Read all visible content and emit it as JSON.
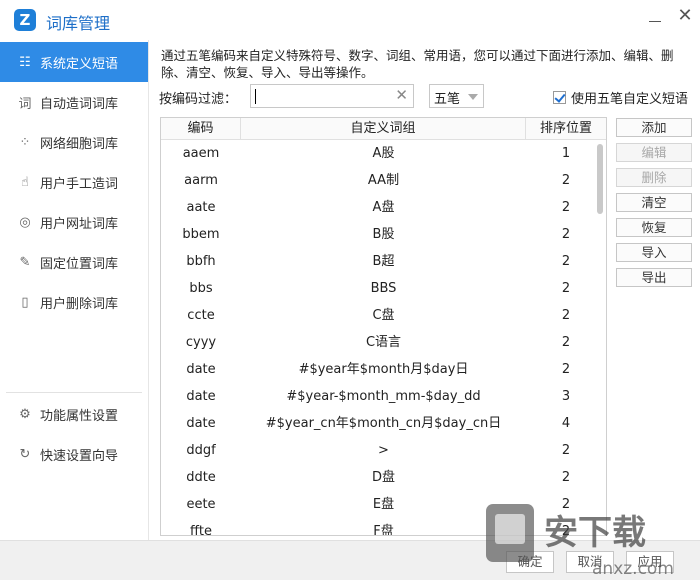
{
  "window": {
    "title": "词库管理",
    "logo_glyph": "Z",
    "close_glyph": "✕"
  },
  "sidebar": {
    "items": [
      {
        "label": "系统定义短语",
        "icon": "list-icon",
        "glyph": "☷",
        "active": true
      },
      {
        "label": "自动造词词库",
        "icon": "word-icon",
        "glyph": "词"
      },
      {
        "label": "网络细胞词库",
        "icon": "network-icon",
        "glyph": "⁘"
      },
      {
        "label": "用户手工造词",
        "icon": "hand-icon",
        "glyph": "☝"
      },
      {
        "label": "用户网址词库",
        "icon": "web-icon",
        "glyph": "◎"
      },
      {
        "label": "固定位置词库",
        "icon": "pin-icon",
        "glyph": "✎"
      },
      {
        "label": "用户删除词库",
        "icon": "trash-icon",
        "glyph": "▯"
      }
    ],
    "bottom_items": [
      {
        "label": "功能属性设置",
        "icon": "gear-icon",
        "glyph": "⚙"
      },
      {
        "label": "快速设置向导",
        "icon": "power-icon",
        "glyph": "↻"
      }
    ]
  },
  "main": {
    "description": "通过五笔编码来自定义特殊符号、数字、词组、常用语，您可以通过下面进行添加、编辑、删除、清空、恢复、导入、导出等操作。",
    "filter_label": "按编码过滤：",
    "filter_value": "",
    "clear_glyph": "✕",
    "ime_value": "五笔",
    "use_custom_label": "使用五笔自定义短语",
    "use_custom_checked": true
  },
  "table": {
    "headers": [
      "编码",
      "自定义词组",
      "排序位置"
    ],
    "rows": [
      [
        "aaem",
        "A股",
        "1"
      ],
      [
        "aarm",
        "AA制",
        "2"
      ],
      [
        "aate",
        "A盘",
        "2"
      ],
      [
        "bbem",
        "B股",
        "2"
      ],
      [
        "bbfh",
        "B超",
        "2"
      ],
      [
        "bbs",
        "BBS",
        "2"
      ],
      [
        "ccte",
        "C盘",
        "2"
      ],
      [
        "cyyy",
        "C语言",
        "2"
      ],
      [
        "date",
        "#$year年$month月$day日",
        "2"
      ],
      [
        "date",
        "#$year-$month_mm-$day_dd",
        "3"
      ],
      [
        "date",
        "#$year_cn年$month_cn月$day_cn日",
        "4"
      ],
      [
        "ddgf",
        ">",
        "2"
      ],
      [
        "ddte",
        "D盘",
        "2"
      ],
      [
        "eete",
        "E盘",
        "2"
      ],
      [
        "ffte",
        "F盘",
        "2"
      ]
    ]
  },
  "actions": [
    {
      "label": "添加",
      "enabled": true
    },
    {
      "label": "编辑",
      "enabled": false
    },
    {
      "label": "删除",
      "enabled": false
    },
    {
      "label": "清空",
      "enabled": true
    },
    {
      "label": "恢复",
      "enabled": true
    },
    {
      "label": "导入",
      "enabled": true
    },
    {
      "label": "导出",
      "enabled": true
    }
  ],
  "footer": {
    "ok_label": "确定",
    "cancel_label": "取消",
    "apply_label": "应用"
  },
  "watermark": {
    "text": "安下载",
    "domain": "anxz.com"
  },
  "colors": {
    "accent": "#2f8be6",
    "title": "#1e6fc8"
  }
}
